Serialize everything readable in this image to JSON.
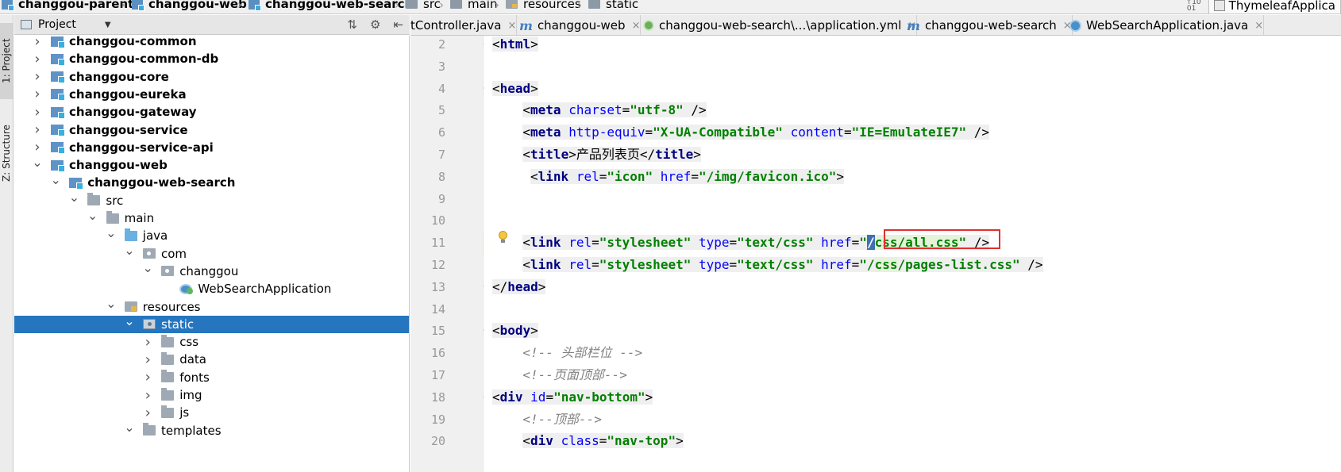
{
  "breadcrumb": [
    {
      "label": "changgou-parent",
      "icon": "module-icon",
      "bold": true
    },
    {
      "label": "changgou-web",
      "icon": "module-icon",
      "bold": true
    },
    {
      "label": "changgou-web-search",
      "icon": "module-icon",
      "bold": true
    },
    {
      "label": "src",
      "icon": "folder-icon",
      "bold": false
    },
    {
      "label": "main",
      "icon": "folder-icon",
      "bold": false
    },
    {
      "label": "resources",
      "icon": "resources-folder-icon",
      "bold": false
    },
    {
      "label": "static",
      "icon": "folder-icon",
      "bold": false
    }
  ],
  "run_config": {
    "label": "ThymeleafApplica"
  },
  "side_tabs": {
    "project": "1: Project",
    "structure": "Z: Structure"
  },
  "project_panel": {
    "title": "Project"
  },
  "tree": [
    {
      "label": "changgou-common",
      "depth": 0,
      "arrow": "right",
      "icon": "module",
      "bold": true
    },
    {
      "label": "changgou-common-db",
      "depth": 0,
      "arrow": "right",
      "icon": "module",
      "bold": true
    },
    {
      "label": "changgou-core",
      "depth": 0,
      "arrow": "right",
      "icon": "module",
      "bold": true
    },
    {
      "label": "changgou-eureka",
      "depth": 0,
      "arrow": "right",
      "icon": "module",
      "bold": true
    },
    {
      "label": "changgou-gateway",
      "depth": 0,
      "arrow": "right",
      "icon": "module",
      "bold": true
    },
    {
      "label": "changgou-service",
      "depth": 0,
      "arrow": "right",
      "icon": "module",
      "bold": true
    },
    {
      "label": "changgou-service-api",
      "depth": 0,
      "arrow": "right",
      "icon": "module",
      "bold": true
    },
    {
      "label": "changgou-web",
      "depth": 0,
      "arrow": "down",
      "icon": "module",
      "bold": true
    },
    {
      "label": "changgou-web-search",
      "depth": 1,
      "arrow": "down",
      "icon": "module",
      "bold": true
    },
    {
      "label": "src",
      "depth": 2,
      "arrow": "down",
      "icon": "folder",
      "bold": false
    },
    {
      "label": "main",
      "depth": 3,
      "arrow": "down",
      "icon": "folder",
      "bold": false
    },
    {
      "label": "java",
      "depth": 4,
      "arrow": "down",
      "icon": "java",
      "bold": false
    },
    {
      "label": "com",
      "depth": 5,
      "arrow": "down",
      "icon": "pkg",
      "bold": false
    },
    {
      "label": "changgou",
      "depth": 6,
      "arrow": "down",
      "icon": "pkg",
      "bold": false
    },
    {
      "label": "WebSearchApplication",
      "depth": 7,
      "arrow": "none",
      "icon": "class",
      "bold": false
    },
    {
      "label": "resources",
      "depth": 4,
      "arrow": "down",
      "icon": "res",
      "bold": false
    },
    {
      "label": "static",
      "depth": 5,
      "arrow": "down",
      "icon": "static",
      "bold": false,
      "selected": true
    },
    {
      "label": "css",
      "depth": 6,
      "arrow": "right",
      "icon": "folder",
      "bold": false
    },
    {
      "label": "data",
      "depth": 6,
      "arrow": "right",
      "icon": "folder",
      "bold": false
    },
    {
      "label": "fonts",
      "depth": 6,
      "arrow": "right",
      "icon": "folder",
      "bold": false
    },
    {
      "label": "img",
      "depth": 6,
      "arrow": "right",
      "icon": "folder",
      "bold": false
    },
    {
      "label": "js",
      "depth": 6,
      "arrow": "right",
      "icon": "folder",
      "bold": false
    },
    {
      "label": "templates",
      "depth": 5,
      "arrow": "down",
      "icon": "folder",
      "bold": false
    }
  ],
  "editor_tabs": [
    {
      "label": "tController.java",
      "icon": "none"
    },
    {
      "label": "changgou-web",
      "icon": "m"
    },
    {
      "label": "changgou-web-search\\...\\application.yml",
      "icon": "leaf"
    },
    {
      "label": "changgou-web-search",
      "icon": "m"
    },
    {
      "label": "WebSearchApplication.java",
      "icon": "class"
    }
  ],
  "code_lines": [
    {
      "no": "2",
      "fold": true,
      "indent": 0,
      "tokens": [
        [
          "br",
          "<"
        ],
        [
          "tag",
          "html"
        ],
        [
          "br",
          ">"
        ]
      ]
    },
    {
      "no": "3",
      "indent": 0,
      "tokens": []
    },
    {
      "no": "4",
      "fold": true,
      "indent": 0,
      "tokens": [
        [
          "br",
          "<"
        ],
        [
          "tag",
          "head"
        ],
        [
          "br",
          ">"
        ]
      ]
    },
    {
      "no": "5",
      "indent": 4,
      "tokens": [
        [
          "br",
          "<"
        ],
        [
          "tag",
          "meta "
        ],
        [
          "attr",
          "charset"
        ],
        [
          "br",
          "="
        ],
        [
          "val",
          "\"utf-8\""
        ],
        [
          "br",
          " />"
        ]
      ]
    },
    {
      "no": "6",
      "indent": 4,
      "tokens": [
        [
          "br",
          "<"
        ],
        [
          "tag",
          "meta "
        ],
        [
          "attr",
          "http-equiv"
        ],
        [
          "br",
          "="
        ],
        [
          "val",
          "\"X-UA-Compatible\""
        ],
        [
          "br",
          " "
        ],
        [
          "attr",
          "content"
        ],
        [
          "br",
          "="
        ],
        [
          "val",
          "\"IE=EmulateIE7\""
        ],
        [
          "br",
          " />"
        ]
      ]
    },
    {
      "no": "7",
      "indent": 4,
      "tokens": [
        [
          "br",
          "<"
        ],
        [
          "tag",
          "title"
        ],
        [
          "br",
          ">"
        ],
        [
          "text",
          "产品列表页"
        ],
        [
          "br",
          "</"
        ],
        [
          "tag",
          "title"
        ],
        [
          "br",
          ">"
        ]
      ]
    },
    {
      "no": "8",
      "indent": 5,
      "tokens": [
        [
          "br",
          "<"
        ],
        [
          "tag",
          "link "
        ],
        [
          "attr",
          "rel"
        ],
        [
          "br",
          "="
        ],
        [
          "val",
          "\"icon\""
        ],
        [
          "br",
          " "
        ],
        [
          "attr",
          "href"
        ],
        [
          "br",
          "="
        ],
        [
          "val",
          "\"/img/favicon.ico\""
        ],
        [
          "br",
          ">"
        ]
      ]
    },
    {
      "no": "9",
      "indent": 0,
      "tokens": []
    },
    {
      "no": "10",
      "indent": 0,
      "tokens": []
    },
    {
      "no": "11",
      "indent": 4,
      "current": true,
      "tokens": [
        [
          "br",
          "<"
        ],
        [
          "tag",
          "link "
        ],
        [
          "attr",
          "rel"
        ],
        [
          "br",
          "="
        ],
        [
          "val",
          "\"stylesheet\""
        ],
        [
          "br",
          " "
        ],
        [
          "attr",
          "type"
        ],
        [
          "br",
          "="
        ],
        [
          "val",
          "\"text/css\""
        ],
        [
          "br",
          " "
        ],
        [
          "attr",
          "href"
        ],
        [
          "br",
          "="
        ],
        [
          "val",
          "\""
        ],
        [
          "caret",
          "/"
        ],
        [
          "valhl",
          "css/all.css"
        ],
        [
          "val",
          "\""
        ],
        [
          "br",
          " />"
        ]
      ]
    },
    {
      "no": "12",
      "indent": 4,
      "tokens": [
        [
          "br",
          "<"
        ],
        [
          "tag",
          "link "
        ],
        [
          "attr",
          "rel"
        ],
        [
          "br",
          "="
        ],
        [
          "val",
          "\"stylesheet\""
        ],
        [
          "br",
          " "
        ],
        [
          "attr",
          "type"
        ],
        [
          "br",
          "="
        ],
        [
          "val",
          "\"text/css\""
        ],
        [
          "br",
          " "
        ],
        [
          "attr",
          "href"
        ],
        [
          "br",
          "="
        ],
        [
          "val",
          "\"/"
        ],
        [
          "valhl",
          "css"
        ],
        [
          "val",
          "/pages-list.css\""
        ],
        [
          "br",
          " />"
        ]
      ]
    },
    {
      "no": "13",
      "fold": true,
      "indent": 0,
      "tokens": [
        [
          "br",
          "</"
        ],
        [
          "tag",
          "head"
        ],
        [
          "br",
          ">"
        ]
      ]
    },
    {
      "no": "14",
      "indent": 0,
      "tokens": []
    },
    {
      "no": "15",
      "fold": true,
      "indent": 0,
      "tokens": [
        [
          "br",
          "<"
        ],
        [
          "tag",
          "body"
        ],
        [
          "br",
          ">"
        ]
      ]
    },
    {
      "no": "16",
      "indent": 4,
      "tokens": [
        [
          "comment",
          "<!-- 头部栏位 -->"
        ]
      ]
    },
    {
      "no": "17",
      "indent": 4,
      "tokens": [
        [
          "comment",
          "<!--页面顶部-->"
        ]
      ]
    },
    {
      "no": "18",
      "fold": true,
      "indent": 0,
      "tokens": [
        [
          "br",
          "<"
        ],
        [
          "tag",
          "div "
        ],
        [
          "attr",
          "id"
        ],
        [
          "br",
          "="
        ],
        [
          "val",
          "\"nav-bottom\""
        ],
        [
          "br",
          ">"
        ]
      ]
    },
    {
      "no": "19",
      "indent": 4,
      "tokens": [
        [
          "comment",
          "<!--顶部-->"
        ]
      ]
    },
    {
      "no": "20",
      "indent": 4,
      "tokens": [
        [
          "br",
          "<"
        ],
        [
          "tag",
          "div "
        ],
        [
          "attr",
          "class"
        ],
        [
          "br",
          "="
        ],
        [
          "val",
          "\"nav-top\""
        ],
        [
          "br",
          ">"
        ]
      ]
    }
  ]
}
